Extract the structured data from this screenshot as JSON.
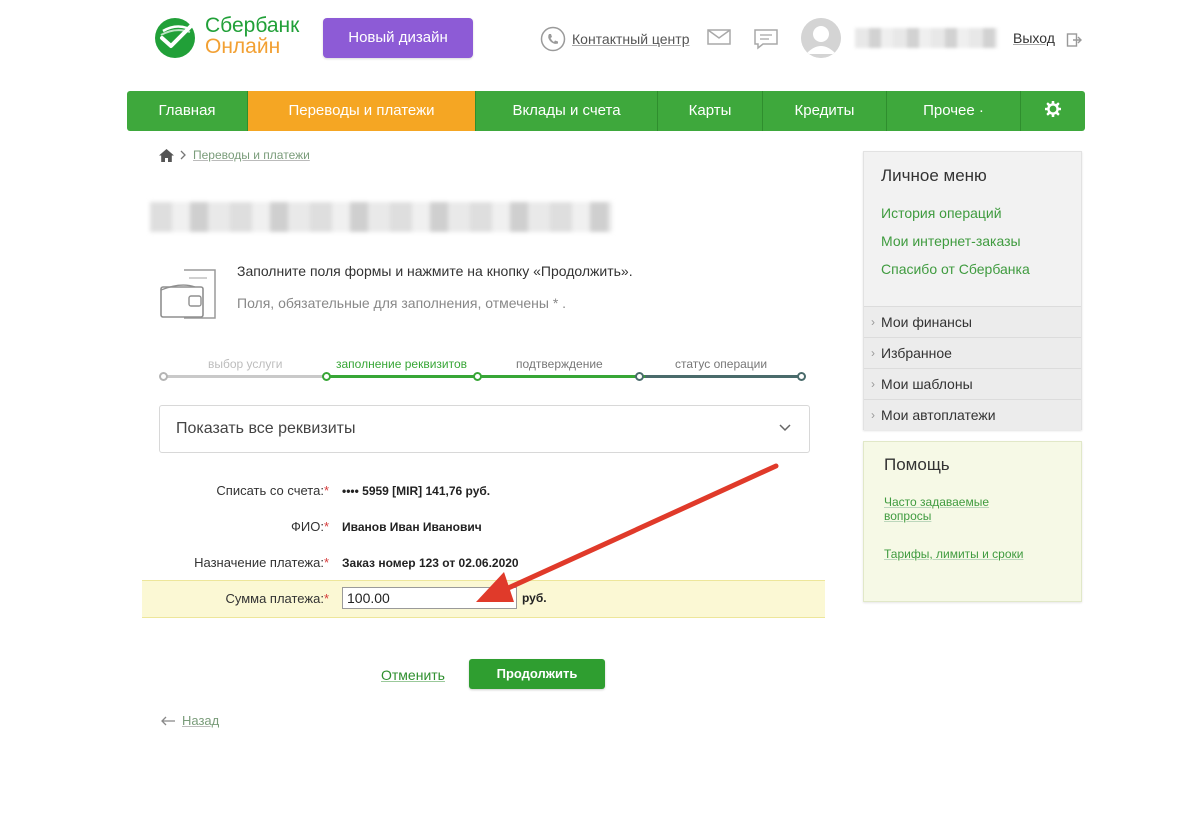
{
  "header": {
    "logo_line1": "Сбербанк",
    "logo_line2": "Онлайн",
    "new_design_label": "Новый дизайн",
    "contact_center_label": "Контактный центр",
    "logout_label": "Выход"
  },
  "nav": {
    "items": [
      {
        "label": "Главная",
        "active": false
      },
      {
        "label": "Переводы и платежи",
        "active": true
      },
      {
        "label": "Вклады и счета",
        "active": false
      },
      {
        "label": "Карты",
        "active": false
      },
      {
        "label": "Кредиты",
        "active": false
      },
      {
        "label": "Прочее ·",
        "active": false
      }
    ],
    "settings_icon": "gear-icon"
  },
  "breadcrumb": {
    "home_icon": "home-icon",
    "link": "Переводы и платежи"
  },
  "info": {
    "line1": "Заполните поля формы и нажмите на кнопку «Продолжить».",
    "line2": "Поля, обязательные для заполнения, отмечены * ."
  },
  "steps": [
    {
      "label": "выбор услуги",
      "state": "done"
    },
    {
      "label": "заполнение реквизитов",
      "state": "current"
    },
    {
      "label": "подтверждение",
      "state": "pending"
    },
    {
      "label": "статус операции",
      "state": "pending"
    }
  ],
  "requisites_toggle_label": "Показать все реквизиты",
  "form": {
    "account_label": "Списать со счета:",
    "account_value": "•••• 5959  [MIR] 141,76   руб.",
    "fio_label": "ФИО:",
    "fio_value": "Иванов Иван Иванович",
    "purpose_label": "Назначение платежа:",
    "purpose_value": "Заказ номер 123 от 02.06.2020",
    "sum_label": "Сумма платежа:",
    "sum_value": "100.00",
    "sum_unit": "руб.",
    "required_mark": "*"
  },
  "actions": {
    "cancel_label": "Отменить",
    "continue_label": "Продолжить",
    "back_label": "Назад"
  },
  "sidebar": {
    "personal_menu_title": "Личное меню",
    "personal_links": [
      "История операций",
      "Мои интернет-заказы",
      "Спасибо от Сбербанка"
    ],
    "personal_items": [
      "Мои финансы",
      "Избранное",
      "Мои шаблоны",
      "Мои автоплатежи"
    ],
    "help_title": "Помощь",
    "help_links": [
      "Часто задаваемые вопросы",
      "Тарифы, лимиты и сроки"
    ]
  },
  "colors": {
    "brand_green": "#3ea83c",
    "active_tab": "#f5a623",
    "new_design_purple": "#8d5bd6",
    "annotation_arrow": "#e03a2a"
  }
}
